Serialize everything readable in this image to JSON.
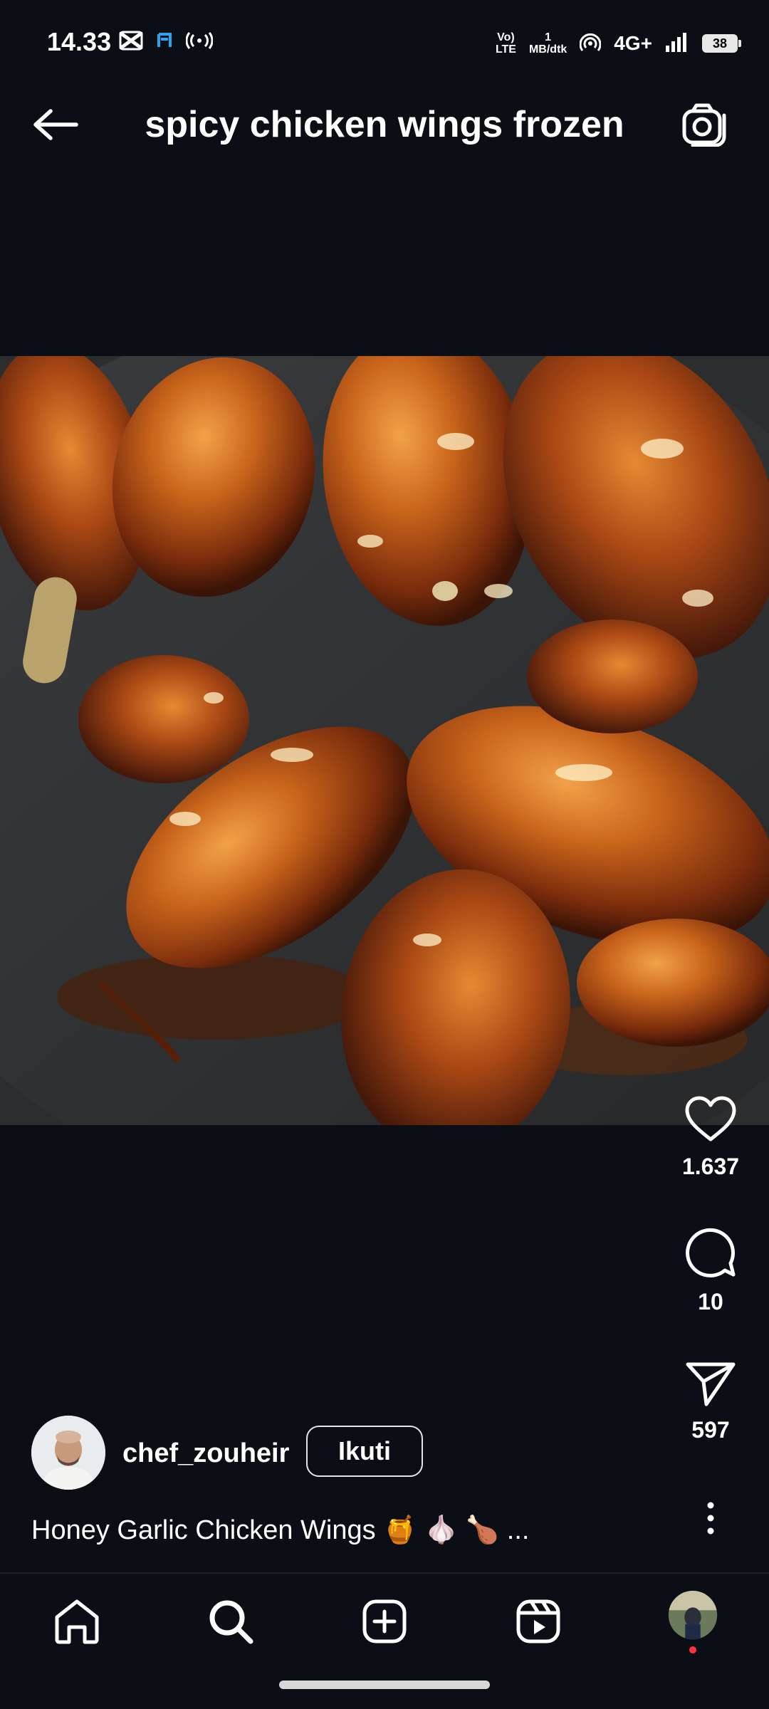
{
  "status_bar": {
    "time": "14.33",
    "volte_line1": "Vo)",
    "volte_line2": "LTE",
    "speed_value": "1",
    "speed_unit": "MB/dtk",
    "network": "4G+",
    "battery": "38",
    "icons": [
      "capcut-icon",
      "app-notification-icon",
      "hotspot-icon",
      "volte-icon",
      "wifi-calling-icon",
      "signal-icon",
      "battery-icon"
    ]
  },
  "header": {
    "title": "spicy chicken wings frozen",
    "back_icon": "arrow-left-icon",
    "camera_icon": "camera-icon"
  },
  "actions": {
    "likes": "1.637",
    "comments": "10",
    "shares": "597"
  },
  "author": {
    "username": "chef_zouheir",
    "follow_label": "Ikuti"
  },
  "caption": {
    "text": "Honey Garlic Chicken Wings 🍯 🧄 🍗 ..."
  },
  "bottom_nav": {
    "items": [
      "home-icon",
      "search-icon",
      "create-icon",
      "reels-icon",
      "profile-avatar"
    ]
  },
  "colors": {
    "background": "#0b0f15",
    "text": "#ffffff",
    "notification_dot": "#ff3040"
  }
}
